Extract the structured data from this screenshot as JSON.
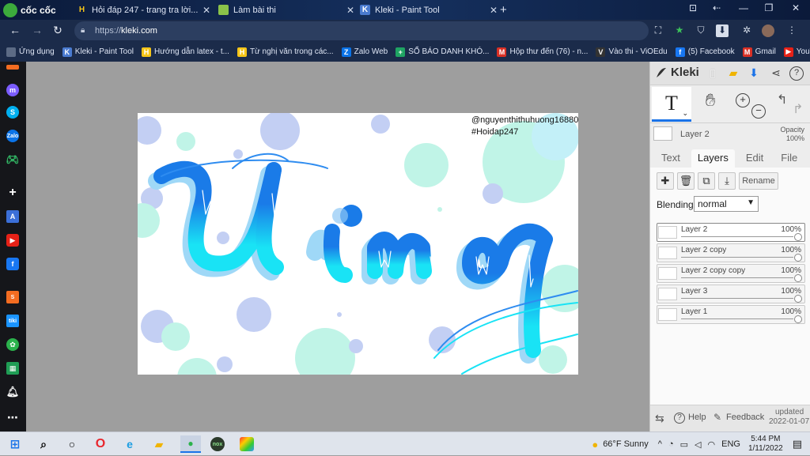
{
  "browser": {
    "logo_text": "cốc cốc",
    "tabs": [
      {
        "label": "Hỏi đáp 247 - trang tra lời...",
        "icon": "H",
        "color": "#f5c518"
      },
      {
        "label": "Làm bài thi",
        "icon": "",
        "color": "#8bc34a"
      },
      {
        "label": "Kleki - Paint Tool",
        "icon": "K",
        "color": "#4a7bd0"
      }
    ],
    "new_tab": "+",
    "url_prefix": "https://",
    "url_host": "kleki.com",
    "bookmarks": [
      {
        "label": "Ứng dụng",
        "icon": "grid-icon",
        "color": "#5c6b85"
      },
      {
        "label": "Kleki - Paint Tool",
        "icon": "K",
        "color": "#4a7bd0"
      },
      {
        "label": "Hướng dẫn latex - t...",
        "icon": "H",
        "color": "#f5c518"
      },
      {
        "label": "Từ nghị văn trong các...",
        "icon": "H",
        "color": "#f5c518"
      },
      {
        "label": "Zalo Web",
        "icon": "Z",
        "color": "#0a73e8"
      },
      {
        "label": "SỔ BÁO DANH KHÓ...",
        "icon": "+",
        "color": "#1fa463"
      },
      {
        "label": "Hộp thư đến (76) - n...",
        "icon": "M",
        "color": "#d93025"
      },
      {
        "label": "Vào thi - ViOEdu",
        "icon": "V",
        "color": "#333333"
      },
      {
        "label": "(5) Facebook",
        "icon": "f",
        "color": "#1877f2"
      },
      {
        "label": "Gmail",
        "icon": "M",
        "color": "#d93025"
      },
      {
        "label": "YouTube",
        "icon": "▶",
        "color": "#e62117"
      }
    ]
  },
  "canvas": {
    "watermark_line1": "@nguyenthithuhuong16880",
    "watermark_line2": "#Hoidap247",
    "word": "Uing"
  },
  "kleki": {
    "brand": "Kleki",
    "tool_active": "T",
    "layer_name": "Layer 2",
    "opacity_label": "Opacity",
    "opacity_value": "100%",
    "tabs": [
      "Text",
      "Layers",
      "Edit",
      "File"
    ],
    "rename": "Rename",
    "blending_label": "Blending",
    "blending_value": "normal",
    "layers": [
      {
        "name": "Layer 2",
        "opacity": "100%"
      },
      {
        "name": "Layer 2 copy",
        "opacity": "100%"
      },
      {
        "name": "Layer 2 copy copy",
        "opacity": "100%"
      },
      {
        "name": "Layer 3",
        "opacity": "100%"
      },
      {
        "name": "Layer 1",
        "opacity": "100%"
      }
    ],
    "help": "Help",
    "feedback": "Feedback",
    "updated_label": "updated",
    "updated_date": "2022-01-07"
  },
  "taskbar": {
    "weather": "66°F  Sunny",
    "lang": "ENG",
    "time": "5:44 PM",
    "date": "1/11/2022"
  },
  "colors": {
    "accent": "#1a73e8",
    "stroke_blue": "#1a7be8",
    "stroke_cyan": "#19e3f5",
    "bubble_mint": "#b6f3e3",
    "bubble_lavender": "#b9c7f2"
  }
}
